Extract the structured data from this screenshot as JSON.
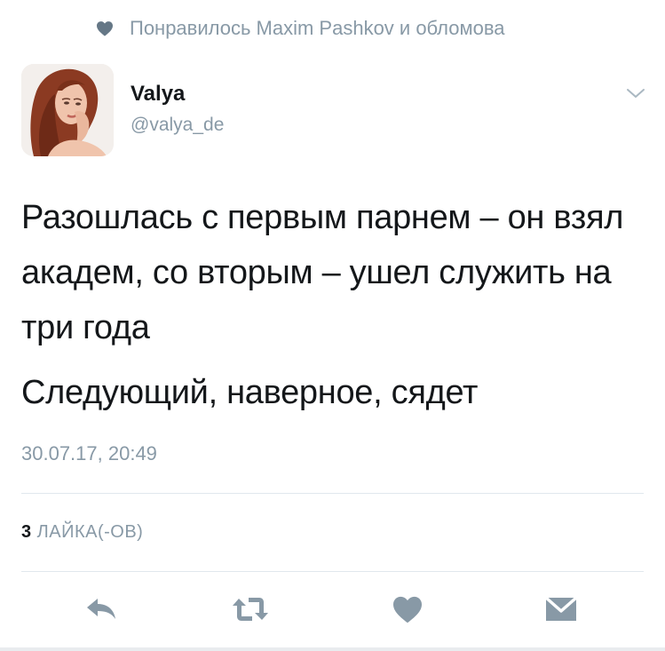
{
  "social_context": {
    "icon": "heart-icon",
    "text": "Понравилось Maxim Pashkov и обломова"
  },
  "author": {
    "display_name": "Valya",
    "handle": "@valya_de"
  },
  "tweet": {
    "paragraphs": [
      "Разошлась с первым парнем – он взял академ, со вторым – ушел служить на три года",
      "Следующий, наверное, сядет"
    ],
    "timestamp": "30.07.17, 20:49"
  },
  "stats": {
    "likes_count": "3",
    "likes_label": "ЛАЙКА(-ОВ)"
  },
  "actions": [
    {
      "name": "reply",
      "icon": "reply-icon"
    },
    {
      "name": "retweet",
      "icon": "retweet-icon"
    },
    {
      "name": "like",
      "icon": "heart-icon"
    },
    {
      "name": "direct-message",
      "icon": "envelope-icon"
    }
  ],
  "colors": {
    "text_primary": "#14171a",
    "text_secondary": "#8899a6",
    "divider": "#e1e8ed",
    "icon": "#8899a6"
  }
}
